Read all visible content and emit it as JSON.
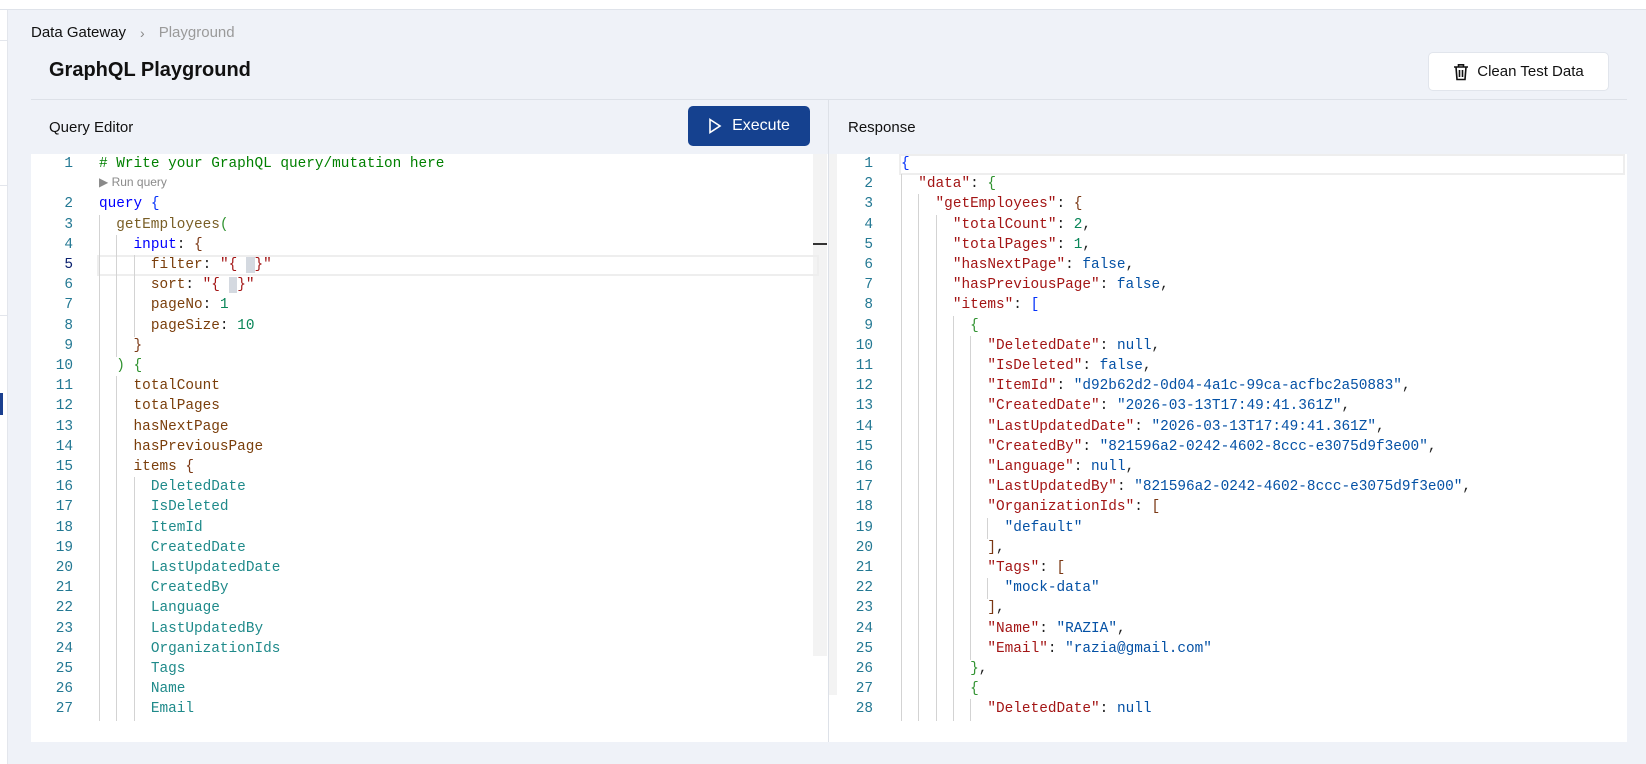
{
  "breadcrumb": [
    "Data Gateway",
    "Playground"
  ],
  "title": "GraphQL Playground",
  "clean_button": "Clean Test Data",
  "query_editor": {
    "label": "Query Editor",
    "execute_label": "Execute",
    "codelens": "▶ Run query",
    "lines": [
      {
        "n": 1,
        "i": 0,
        "t": [
          [
            "comment",
            "# Write your GraphQL query/mutation here"
          ]
        ]
      },
      {
        "lens": true
      },
      {
        "n": 2,
        "i": 0,
        "t": [
          [
            "kw",
            "query"
          ],
          [
            "p",
            " "
          ],
          [
            "b1",
            "{"
          ]
        ]
      },
      {
        "n": 3,
        "i": 1,
        "t": [
          [
            "fn",
            "getEmployees"
          ],
          [
            "b2",
            "("
          ]
        ]
      },
      {
        "n": 4,
        "i": 2,
        "t": [
          [
            "kw",
            "input"
          ],
          [
            "p",
            ": "
          ],
          [
            "b3",
            "{"
          ]
        ]
      },
      {
        "n": 5,
        "i": 3,
        "cur": true,
        "t": [
          [
            "field",
            "filter"
          ],
          [
            "p",
            ": "
          ],
          [
            "str",
            "\"{ "
          ],
          [
            "sel",
            " "
          ],
          [
            "str",
            "}\""
          ]
        ]
      },
      {
        "n": 6,
        "i": 3,
        "t": [
          [
            "field",
            "sort"
          ],
          [
            "p",
            ": "
          ],
          [
            "str",
            "\"{ "
          ],
          [
            "sel",
            " "
          ],
          [
            "str",
            "}\""
          ]
        ]
      },
      {
        "n": 7,
        "i": 3,
        "t": [
          [
            "field",
            "pageNo"
          ],
          [
            "p",
            ": "
          ],
          [
            "num",
            "1"
          ]
        ]
      },
      {
        "n": 8,
        "i": 3,
        "t": [
          [
            "field",
            "pageSize"
          ],
          [
            "p",
            ": "
          ],
          [
            "num",
            "10"
          ]
        ]
      },
      {
        "n": 9,
        "i": 2,
        "t": [
          [
            "b3",
            "}"
          ]
        ]
      },
      {
        "n": 10,
        "i": 1,
        "t": [
          [
            "b2",
            ")"
          ],
          [
            "p",
            " "
          ],
          [
            "b2",
            "{"
          ]
        ]
      },
      {
        "n": 11,
        "i": 2,
        "t": [
          [
            "field",
            "totalCount"
          ]
        ]
      },
      {
        "n": 12,
        "i": 2,
        "t": [
          [
            "field",
            "totalPages"
          ]
        ]
      },
      {
        "n": 13,
        "i": 2,
        "t": [
          [
            "field",
            "hasNextPage"
          ]
        ]
      },
      {
        "n": 14,
        "i": 2,
        "t": [
          [
            "field",
            "hasPreviousPage"
          ]
        ]
      },
      {
        "n": 15,
        "i": 2,
        "t": [
          [
            "field",
            "items"
          ],
          [
            "p",
            " "
          ],
          [
            "b3",
            "{"
          ]
        ]
      },
      {
        "n": 16,
        "i": 3,
        "t": [
          [
            "sub",
            "DeletedDate"
          ]
        ]
      },
      {
        "n": 17,
        "i": 3,
        "t": [
          [
            "sub",
            "IsDeleted"
          ]
        ]
      },
      {
        "n": 18,
        "i": 3,
        "t": [
          [
            "sub",
            "ItemId"
          ]
        ]
      },
      {
        "n": 19,
        "i": 3,
        "t": [
          [
            "sub",
            "CreatedDate"
          ]
        ]
      },
      {
        "n": 20,
        "i": 3,
        "t": [
          [
            "sub",
            "LastUpdatedDate"
          ]
        ]
      },
      {
        "n": 21,
        "i": 3,
        "t": [
          [
            "sub",
            "CreatedBy"
          ]
        ]
      },
      {
        "n": 22,
        "i": 3,
        "t": [
          [
            "sub",
            "Language"
          ]
        ]
      },
      {
        "n": 23,
        "i": 3,
        "t": [
          [
            "sub",
            "LastUpdatedBy"
          ]
        ]
      },
      {
        "n": 24,
        "i": 3,
        "t": [
          [
            "sub",
            "OrganizationIds"
          ]
        ]
      },
      {
        "n": 25,
        "i": 3,
        "t": [
          [
            "sub",
            "Tags"
          ]
        ]
      },
      {
        "n": 26,
        "i": 3,
        "t": [
          [
            "sub",
            "Name"
          ]
        ]
      },
      {
        "n": 27,
        "i": 3,
        "t": [
          [
            "sub",
            "Email"
          ]
        ]
      }
    ]
  },
  "response": {
    "label": "Response",
    "lines": [
      {
        "n": 1,
        "i": 0,
        "cur": true,
        "t": [
          [
            "b1",
            "{"
          ]
        ]
      },
      {
        "n": 2,
        "i": 1,
        "t": [
          [
            "key",
            "\"data\""
          ],
          [
            "p",
            ": "
          ],
          [
            "b2",
            "{"
          ]
        ]
      },
      {
        "n": 3,
        "i": 2,
        "t": [
          [
            "key",
            "\"getEmployees\""
          ],
          [
            "p",
            ": "
          ],
          [
            "b3",
            "{"
          ]
        ]
      },
      {
        "n": 4,
        "i": 3,
        "t": [
          [
            "key",
            "\"totalCount\""
          ],
          [
            "p",
            ": "
          ],
          [
            "num",
            "2"
          ],
          [
            "p",
            ","
          ]
        ]
      },
      {
        "n": 5,
        "i": 3,
        "t": [
          [
            "key",
            "\"totalPages\""
          ],
          [
            "p",
            ": "
          ],
          [
            "num",
            "1"
          ],
          [
            "p",
            ","
          ]
        ]
      },
      {
        "n": 6,
        "i": 3,
        "t": [
          [
            "key",
            "\"hasNextPage\""
          ],
          [
            "p",
            ": "
          ],
          [
            "val",
            "false"
          ],
          [
            "p",
            ","
          ]
        ]
      },
      {
        "n": 7,
        "i": 3,
        "t": [
          [
            "key",
            "\"hasPreviousPage\""
          ],
          [
            "p",
            ": "
          ],
          [
            "val",
            "false"
          ],
          [
            "p",
            ","
          ]
        ]
      },
      {
        "n": 8,
        "i": 3,
        "t": [
          [
            "key",
            "\"items\""
          ],
          [
            "p",
            ": "
          ],
          [
            "b1",
            "["
          ]
        ]
      },
      {
        "n": 9,
        "i": 4,
        "t": [
          [
            "b2",
            "{"
          ]
        ]
      },
      {
        "n": 10,
        "i": 5,
        "t": [
          [
            "key",
            "\"DeletedDate\""
          ],
          [
            "p",
            ": "
          ],
          [
            "val",
            "null"
          ],
          [
            "p",
            ","
          ]
        ]
      },
      {
        "n": 11,
        "i": 5,
        "t": [
          [
            "key",
            "\"IsDeleted\""
          ],
          [
            "p",
            ": "
          ],
          [
            "val",
            "false"
          ],
          [
            "p",
            ","
          ]
        ]
      },
      {
        "n": 12,
        "i": 5,
        "t": [
          [
            "key",
            "\"ItemId\""
          ],
          [
            "p",
            ": "
          ],
          [
            "val",
            "\"d92b62d2-0d04-4a1c-99ca-acfbc2a50883\""
          ],
          [
            "p",
            ","
          ]
        ]
      },
      {
        "n": 13,
        "i": 5,
        "t": [
          [
            "key",
            "\"CreatedDate\""
          ],
          [
            "p",
            ": "
          ],
          [
            "val",
            "\"2026-03-13T17:49:41.361Z\""
          ],
          [
            "p",
            ","
          ]
        ]
      },
      {
        "n": 14,
        "i": 5,
        "t": [
          [
            "key",
            "\"LastUpdatedDate\""
          ],
          [
            "p",
            ": "
          ],
          [
            "val",
            "\"2026-03-13T17:49:41.361Z\""
          ],
          [
            "p",
            ","
          ]
        ]
      },
      {
        "n": 15,
        "i": 5,
        "t": [
          [
            "key",
            "\"CreatedBy\""
          ],
          [
            "p",
            ": "
          ],
          [
            "val",
            "\"821596a2-0242-4602-8ccc-e3075d9f3e00\""
          ],
          [
            "p",
            ","
          ]
        ]
      },
      {
        "n": 16,
        "i": 5,
        "t": [
          [
            "key",
            "\"Language\""
          ],
          [
            "p",
            ": "
          ],
          [
            "val",
            "null"
          ],
          [
            "p",
            ","
          ]
        ]
      },
      {
        "n": 17,
        "i": 5,
        "t": [
          [
            "key",
            "\"LastUpdatedBy\""
          ],
          [
            "p",
            ": "
          ],
          [
            "val",
            "\"821596a2-0242-4602-8ccc-e3075d9f3e00\""
          ],
          [
            "p",
            ","
          ]
        ]
      },
      {
        "n": 18,
        "i": 5,
        "t": [
          [
            "key",
            "\"OrganizationIds\""
          ],
          [
            "p",
            ": "
          ],
          [
            "b3",
            "["
          ]
        ]
      },
      {
        "n": 19,
        "i": 6,
        "t": [
          [
            "val",
            "\"default\""
          ]
        ]
      },
      {
        "n": 20,
        "i": 5,
        "t": [
          [
            "b3",
            "]"
          ],
          [
            "p",
            ","
          ]
        ]
      },
      {
        "n": 21,
        "i": 5,
        "t": [
          [
            "key",
            "\"Tags\""
          ],
          [
            "p",
            ": "
          ],
          [
            "b3",
            "["
          ]
        ]
      },
      {
        "n": 22,
        "i": 6,
        "t": [
          [
            "val",
            "\"mock-data\""
          ]
        ]
      },
      {
        "n": 23,
        "i": 5,
        "t": [
          [
            "b3",
            "]"
          ],
          [
            "p",
            ","
          ]
        ]
      },
      {
        "n": 24,
        "i": 5,
        "t": [
          [
            "key",
            "\"Name\""
          ],
          [
            "p",
            ": "
          ],
          [
            "val",
            "\"RAZIA\""
          ],
          [
            "p",
            ","
          ]
        ]
      },
      {
        "n": 25,
        "i": 5,
        "t": [
          [
            "key",
            "\"Email\""
          ],
          [
            "p",
            ": "
          ],
          [
            "val",
            "\"razia@gmail.com\""
          ]
        ]
      },
      {
        "n": 26,
        "i": 4,
        "t": [
          [
            "b2",
            "}"
          ],
          [
            "p",
            ","
          ]
        ]
      },
      {
        "n": 27,
        "i": 4,
        "t": [
          [
            "b2",
            "{"
          ]
        ]
      },
      {
        "n": 28,
        "i": 5,
        "t": [
          [
            "key",
            "\"DeletedDate\""
          ],
          [
            "p",
            ": "
          ],
          [
            "val",
            "null"
          ]
        ]
      }
    ]
  }
}
